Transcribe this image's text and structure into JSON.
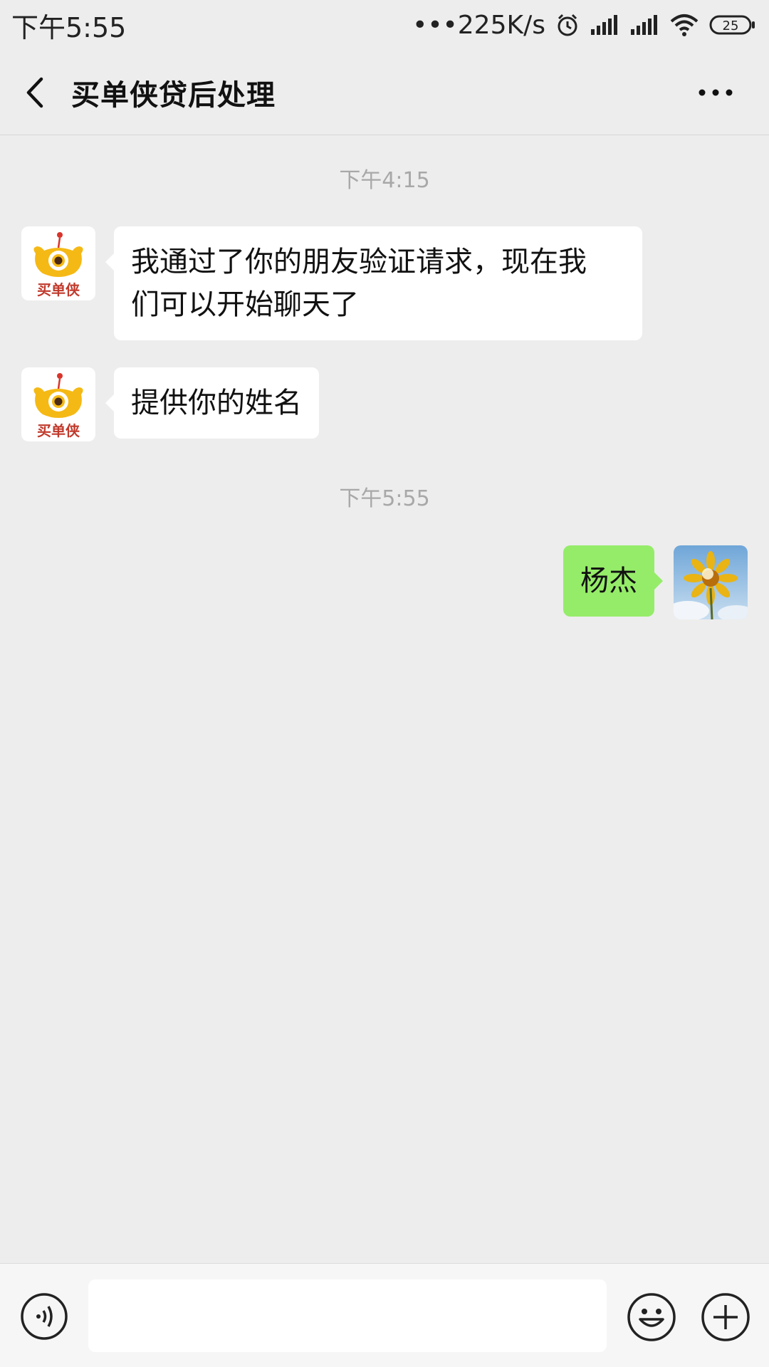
{
  "status_bar": {
    "time": "下午5:55",
    "network_speed": "•••225K/s",
    "battery": "25",
    "icons": [
      "alarm-icon",
      "signal-icon",
      "signal-icon",
      "wifi-icon",
      "battery-icon"
    ]
  },
  "header": {
    "title": "买单侠贷后处理",
    "back_icon": "chevron-left-icon",
    "more_icon": "more-dots-icon"
  },
  "messages": [
    {
      "type": "timestamp",
      "text": "下午4:15"
    },
    {
      "type": "received",
      "sender_avatar": "maidanxia-logo",
      "text_line1": "我通过了你的朋友验证请求，现在我",
      "text_line2": "们可以开始聊天了"
    },
    {
      "type": "received",
      "sender_avatar": "maidanxia-logo",
      "text": "提供你的姓名"
    },
    {
      "type": "timestamp",
      "text": "下午5:55"
    },
    {
      "type": "sent",
      "sender_avatar": "sunflower-photo",
      "text": "杨杰"
    }
  ],
  "brand_logo_text": "买单侠",
  "input_bar": {
    "voice_icon": "voice-icon",
    "input_value": "",
    "emoji_icon": "emoji-icon",
    "plus_icon": "plus-icon"
  },
  "colors": {
    "background": "#ededed",
    "sent_bubble": "#95ec69",
    "received_bubble": "#ffffff",
    "timestamp": "#a8a8a8"
  }
}
